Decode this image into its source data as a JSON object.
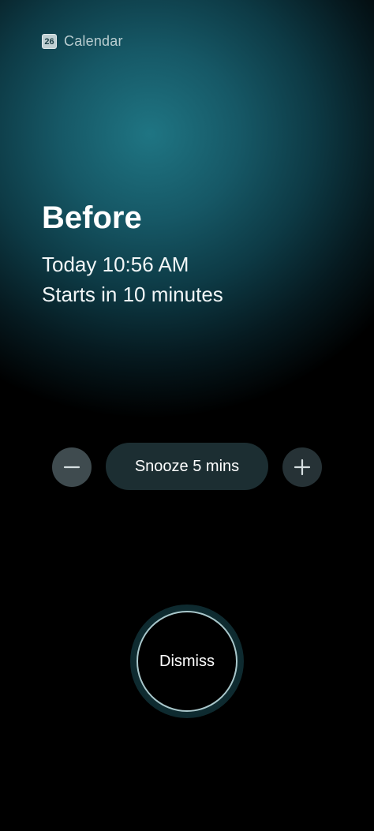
{
  "app": {
    "icon_text": "26",
    "name": "Calendar"
  },
  "event": {
    "title": "Before",
    "time": "Today 10:56 AM",
    "starts_in": "Starts in 10 minutes"
  },
  "snooze": {
    "label": "Snooze 5 mins",
    "decrease_icon": "minus-icon",
    "increase_icon": "plus-icon"
  },
  "dismiss": {
    "label": "Dismiss"
  },
  "colors": {
    "accent": "#1f7583",
    "background": "#000000",
    "ring": "#a9c7cb"
  }
}
